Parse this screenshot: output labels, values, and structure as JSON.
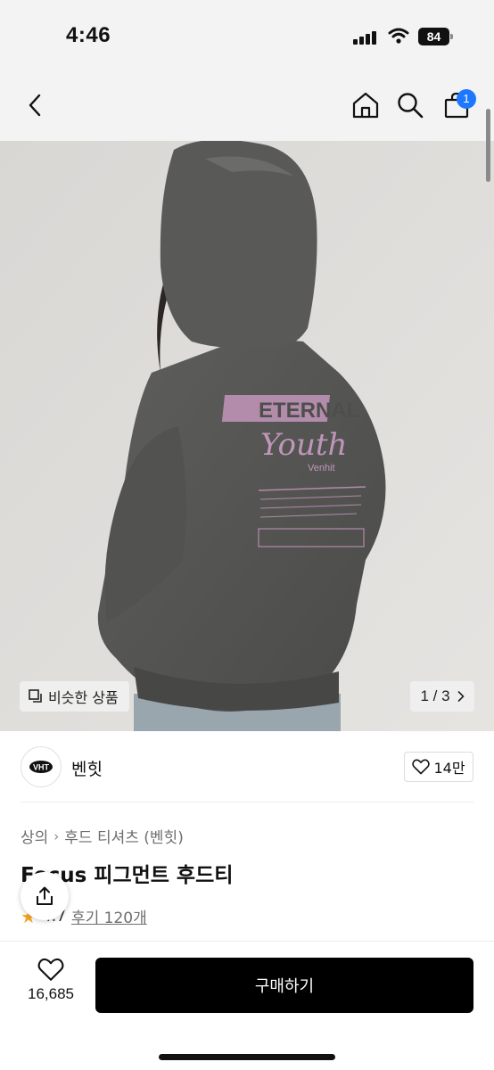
{
  "status_bar": {
    "time": "4:46",
    "battery": "84",
    "icons": [
      "cellular-signal-icon",
      "wifi-icon",
      "battery-icon"
    ]
  },
  "nav": {
    "back_icon": "chevron-left-icon",
    "home_icon": "home-icon",
    "search_icon": "search-icon",
    "cart_icon": "shopping-bag-icon",
    "cart_badge": "1",
    "accent_color": "#1e78ff"
  },
  "gallery": {
    "similar_products_label": "비슷한 상품",
    "similar_icon": "copy-icon",
    "page_indicator": "1 / 3",
    "next_icon": "chevron-right-icon",
    "print_lines": [
      "ETERNAL",
      "Youth",
      "Venhit"
    ]
  },
  "brand": {
    "name": "벤힛",
    "logo_text": "VHT",
    "like_count": "14만",
    "like_icon": "heart-outline-icon"
  },
  "product": {
    "breadcrumb": [
      "상의",
      "후드 티셔츠 (벤힛)"
    ],
    "title": "Focus 피그먼트 후드티",
    "rating": "4.7",
    "reviews_label": "후기 120개",
    "star_color": "#f6a623"
  },
  "bottom_bar": {
    "wish_count": "16,685",
    "buy_label": "구매하기",
    "share_icon": "share-icon",
    "buy_button_color": "#000000"
  }
}
